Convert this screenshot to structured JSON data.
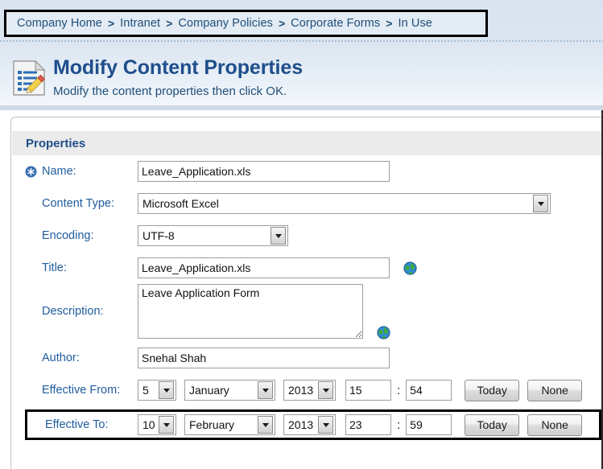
{
  "breadcrumb": {
    "separator": ">",
    "items": [
      {
        "label": "Company Home"
      },
      {
        "label": "Intranet"
      },
      {
        "label": "Company Policies"
      },
      {
        "label": "Corporate Forms"
      },
      {
        "label": "In Use"
      }
    ]
  },
  "header": {
    "title": "Modify Content Properties",
    "subtitle": "Modify the content properties then click OK.",
    "icon": "document-edit-icon"
  },
  "panel": {
    "section_title": "Properties"
  },
  "fields": {
    "name": {
      "label": "Name:",
      "value": "Leave_Application.xls",
      "required": true,
      "required_icon": "required-asterisk-icon"
    },
    "content_type": {
      "label": "Content Type:",
      "value": "Microsoft Excel"
    },
    "encoding": {
      "label": "Encoding:",
      "value": "UTF-8"
    },
    "title": {
      "label": "Title:",
      "value": "Leave_Application.xls",
      "globe_icon": "globe-icon"
    },
    "description": {
      "label": "Description:",
      "value": "Leave Application Form",
      "globe_icon": "globe-icon"
    },
    "author": {
      "label": "Author:",
      "value": "Snehal Shah"
    },
    "effective_from": {
      "label": "Effective From:",
      "day": "5",
      "month": "January",
      "year": "2013",
      "hour": "15",
      "minute": "54",
      "time_separator": ":",
      "today_label": "Today",
      "none_label": "None"
    },
    "effective_to": {
      "label": "Effective To:",
      "day": "10",
      "month": "February",
      "year": "2013",
      "hour": "23",
      "minute": "59",
      "time_separator": ":",
      "today_label": "Today",
      "none_label": "None",
      "highlighted": true
    }
  },
  "colors": {
    "link_blue": "#1f4e79",
    "label_blue": "#1f5c9e",
    "title_blue": "#1f4e8c",
    "banner_top": "#d8e3ef",
    "section_band": "#ebebeb",
    "highlight_border": "#000000"
  }
}
